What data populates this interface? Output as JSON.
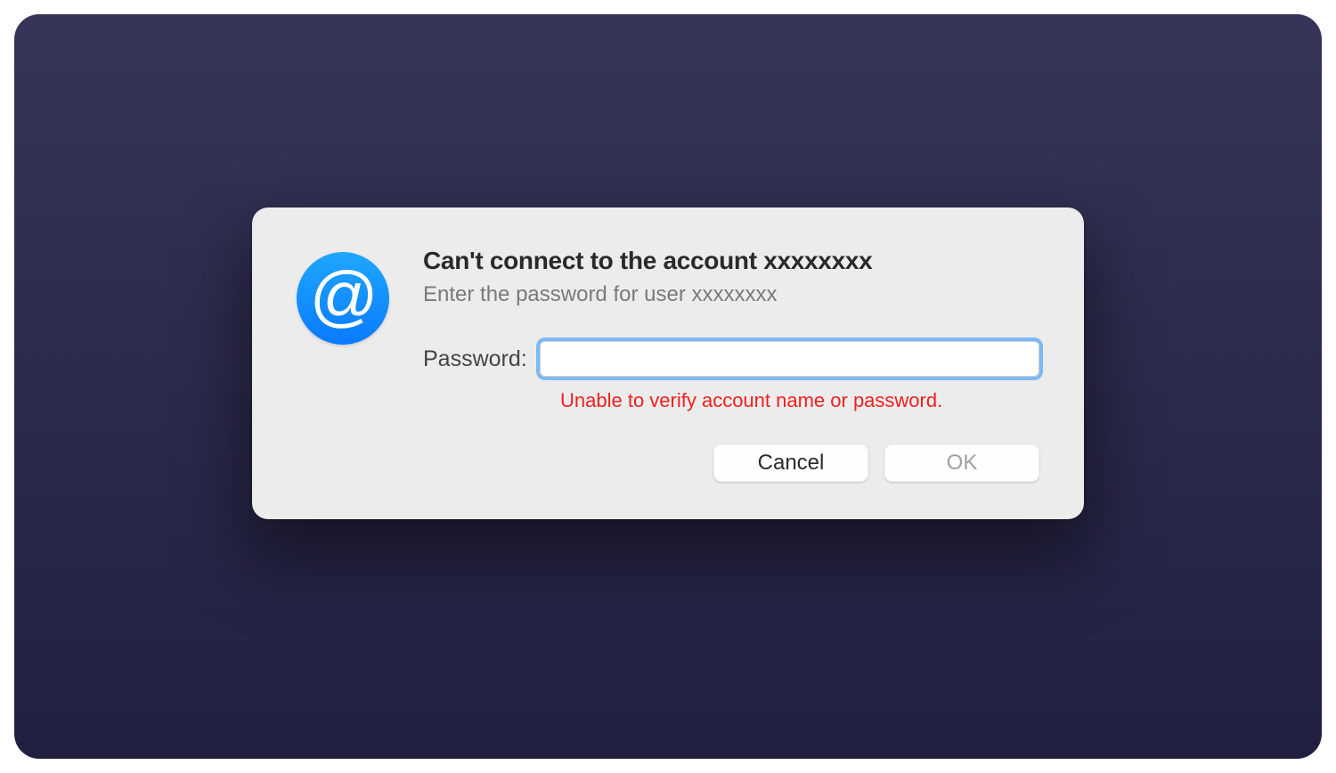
{
  "dialog": {
    "icon": "at-sign-icon",
    "title": "Can't connect to the account xxxxxxxx",
    "subtitle": "Enter the password for user xxxxxxxx",
    "password_label": "Password:",
    "password_value": "",
    "error_message": "Unable to verify account name or password.",
    "buttons": {
      "cancel": "Cancel",
      "ok": "OK"
    }
  }
}
